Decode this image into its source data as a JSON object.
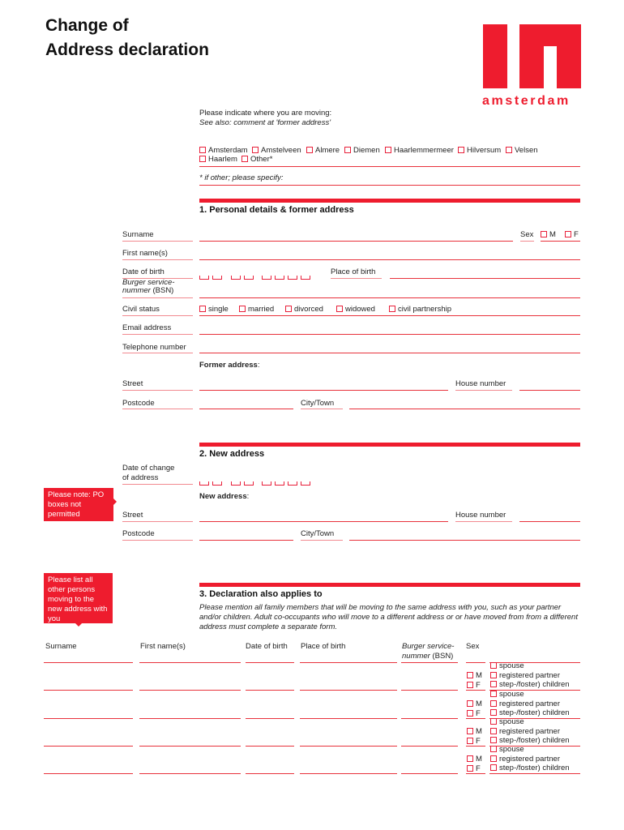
{
  "header": {
    "title_line1": "Change of",
    "title_line2": "Address declaration",
    "logo_text": "amsterdam",
    "brand_color": "#ee1c2e"
  },
  "moving": {
    "prompt": "Please indicate where you are moving:",
    "see_also": "See also: comment at 'former address'",
    "options": [
      "Amsterdam",
      "Amstelveen",
      "Almere",
      "Diemen",
      "Haarlemmermeer",
      "Hilversum",
      "Velsen",
      "Haarlem",
      "Other*"
    ],
    "other_specify": "* if other; please specify:"
  },
  "section1": {
    "heading": "1.  Personal details & former address",
    "surname": "Surname",
    "sex": "Sex",
    "sex_m": "M",
    "sex_f": "F",
    "first_names": "First name(s)",
    "dob": "Date of birth",
    "place_of_birth": "Place of birth",
    "bsn_line1": "Burger service-",
    "bsn_line2": "nummer",
    "bsn_abbr": "(BSN)",
    "civil_status": "Civil status",
    "civil_options": [
      "single",
      "married",
      "divorced",
      "widowed",
      "civil partnership"
    ],
    "email": "Email address",
    "telephone": "Telephone number",
    "former_address": "Former address",
    "street": "Street",
    "house_number": "House number",
    "postcode": "Postcode",
    "city": "City/Town"
  },
  "section2": {
    "heading": "2.  New address",
    "date_change_line1": "Date of change",
    "date_change_line2": "of address",
    "note": "Please note: PO boxes not permitted",
    "new_address": "New address",
    "street": "Street",
    "house_number": "House number",
    "postcode": "Postcode",
    "city": "City/Town"
  },
  "section3": {
    "heading": "3.  Declaration also applies to",
    "note": "Please list all other persons moving to the new address with you",
    "description": "Please mention all family members that will be moving to the same address with you, such as your partner and/or children. Adult co-occupants who will move to a different address or or have moved from from a different address must complete a separate form.",
    "columns": {
      "surname": "Surname",
      "first_names": "First name(s)",
      "dob": "Date of birth",
      "place_of_birth": "Place of birth",
      "bsn_line1": "Burger service-",
      "bsn_line2": "nummer",
      "bsn_abbr": "(BSN)",
      "sex": "Sex"
    },
    "sex_options": [
      "M",
      "F"
    ],
    "relation_options": [
      "spouse",
      "registered partner",
      "step-/foster) children"
    ],
    "row_count": 4
  }
}
